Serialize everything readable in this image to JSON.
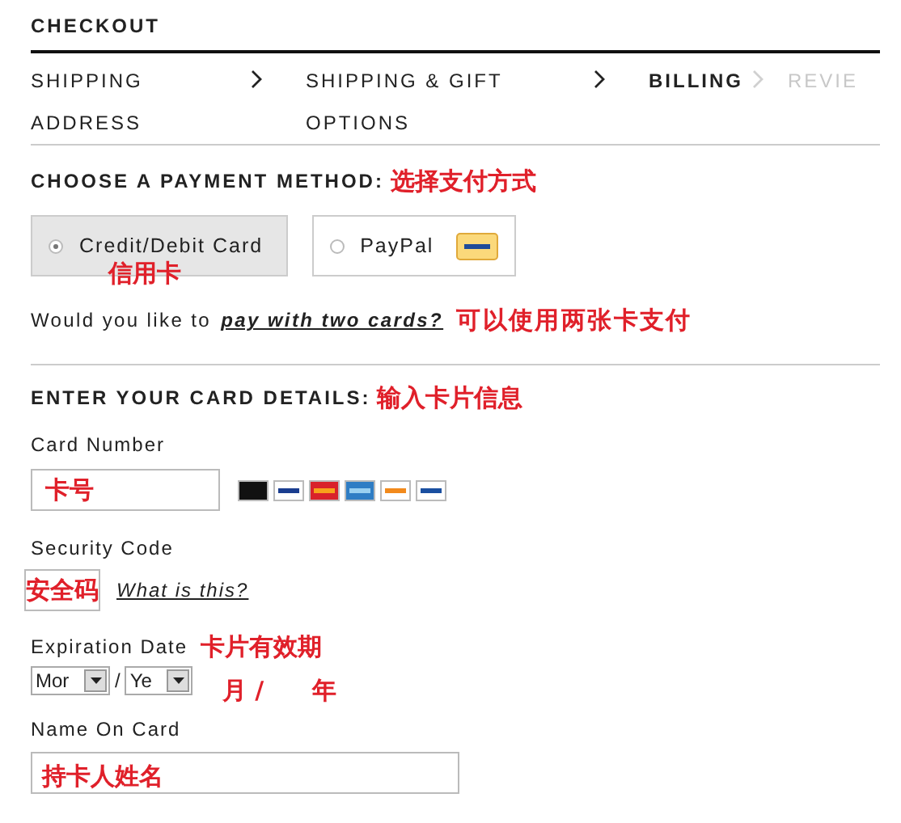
{
  "header": {
    "title": "CHECKOUT"
  },
  "steps": [
    {
      "lines": [
        "SHIPPING",
        "ADDRESS"
      ],
      "selected": false,
      "disabled": false
    },
    {
      "lines": [
        "SHIPPING & GIFT",
        "OPTIONS"
      ],
      "selected": false,
      "disabled": false
    },
    {
      "lines": [
        "BILLING"
      ],
      "selected": true,
      "disabled": false
    },
    {
      "lines": [
        "REVIE"
      ],
      "selected": false,
      "disabled": true
    }
  ],
  "payment": {
    "heading": "CHOOSE A PAYMENT METHOD:",
    "annotation": "选择支付方式",
    "methods": [
      {
        "label": "Credit/Debit Card",
        "selected": true,
        "annotation": "信用卡",
        "kind": "card"
      },
      {
        "label": "PayPal",
        "selected": false,
        "kind": "paypal"
      }
    ],
    "split_prompt": "Would you like to",
    "split_link": "pay with two cards?",
    "split_annotation": "可以使用两张卡支付"
  },
  "card_details": {
    "heading": "ENTER YOUR CARD DETAILS:",
    "annotation": "输入卡片信息",
    "card_number": {
      "label": "Card Number",
      "annotation": "卡号"
    },
    "security_code": {
      "label": "Security Code",
      "annotation": "安全码",
      "help_link": "What is this?"
    },
    "expiration": {
      "label": "Expiration Date",
      "annotation": "卡片有效期",
      "month": "Mor",
      "separator": "/",
      "year": "Ye",
      "month_annotation": "月 /",
      "year_annotation": "年"
    },
    "name_on_card": {
      "label": "Name On Card",
      "annotation": "持卡人姓名"
    }
  }
}
